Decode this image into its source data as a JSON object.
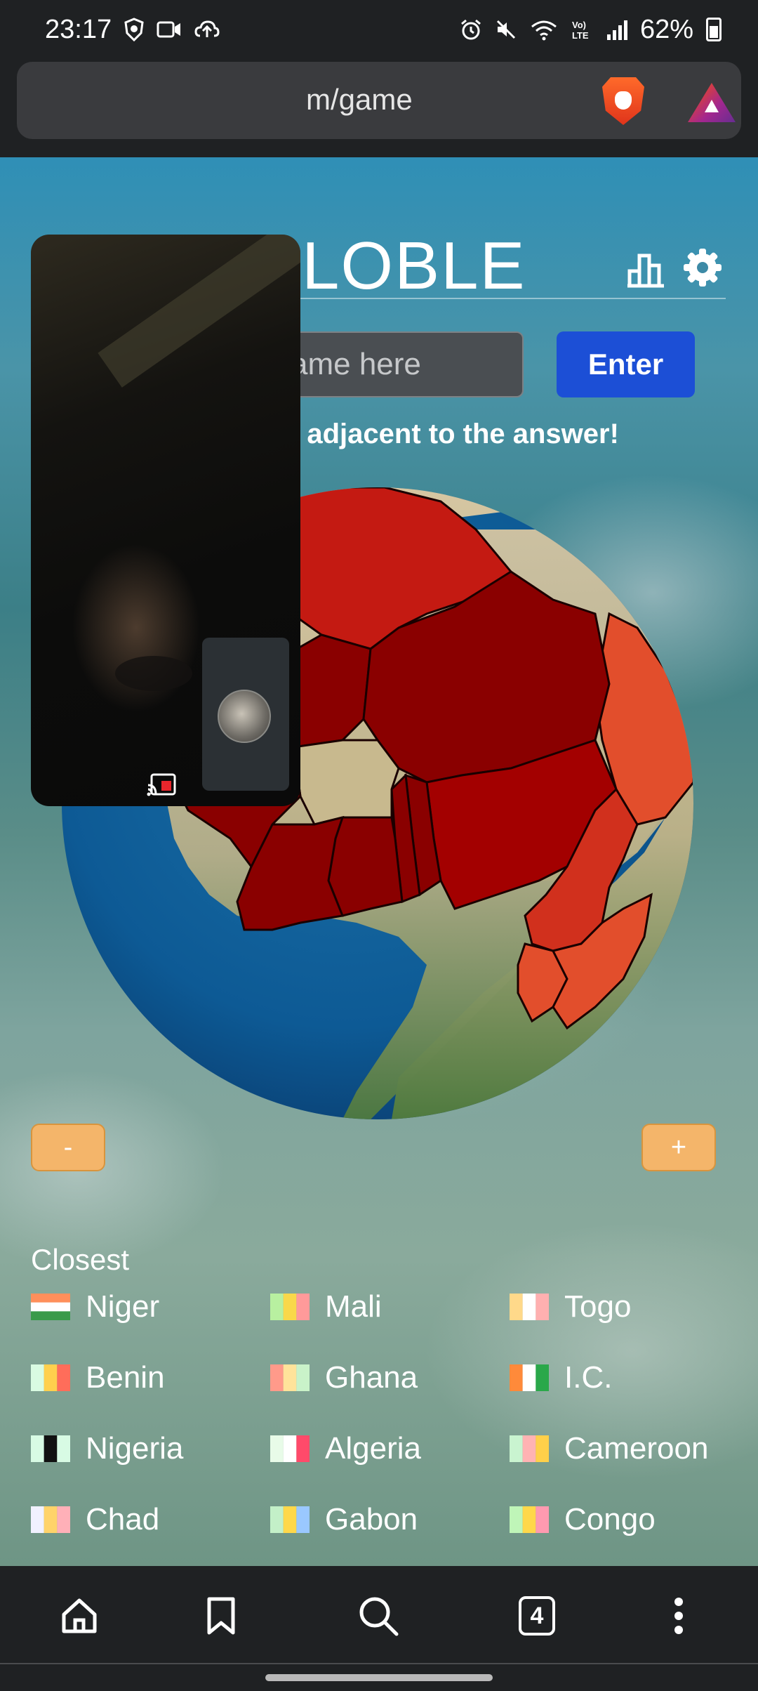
{
  "status_bar": {
    "time": "23:17",
    "battery": "62%",
    "left_icons": [
      "brave-shield-icon",
      "video-icon",
      "cloud-upload-icon"
    ],
    "right_icons": [
      "alarm-icon",
      "mute-icon",
      "wifi-icon",
      "volte-icon",
      "signal-icon",
      "battery-icon"
    ]
  },
  "browser": {
    "url_visible": "m/game",
    "tab_count": "4"
  },
  "game": {
    "title_visible": "LOBLE",
    "input_placeholder": "ame here",
    "enter_label": "Enter",
    "hint": "s adjacent to the answer!",
    "zoom_out": "-",
    "zoom_in": "+",
    "closest_title": "Closest",
    "closest": [
      {
        "name": "Niger",
        "flag": [
          "#ff8f5b",
          "#ffffff",
          "#3a9a4a"
        ]
      },
      {
        "name": "Mali",
        "flag": [
          "#b8f0a0",
          "#f9d84a",
          "#ff9a9a"
        ]
      },
      {
        "name": "Togo",
        "flag": [
          "#ffd98a",
          "#ffffff",
          "#ffb0b0"
        ]
      },
      {
        "name": "Benin",
        "flag": [
          "#d9fbe2",
          "#ffd04d",
          "#ff6d5a"
        ]
      },
      {
        "name": "Ghana",
        "flag": [
          "#ff9a8a",
          "#ffe39a",
          "#c9f2c9"
        ]
      },
      {
        "name": "I.C.",
        "flag": [
          "#ff8a3a",
          "#ffffff",
          "#2aa84a"
        ]
      },
      {
        "name": "Nigeria",
        "flag": [
          "#d8fbe4",
          "#111111",
          "#d8fbe4"
        ]
      },
      {
        "name": "Algeria",
        "flag": [
          "#e8fbe8",
          "#ffffff",
          "#ff4a6a"
        ]
      },
      {
        "name": "Cameroon",
        "flag": [
          "#c9f4d0",
          "#ffb3b3",
          "#ffd04a"
        ]
      },
      {
        "name": "Chad",
        "flag": [
          "#f1f1ff",
          "#ffd36a",
          "#ffb0b8"
        ]
      },
      {
        "name": "Gabon",
        "flag": [
          "#c3f0c8",
          "#ffd84a",
          "#9ac8ff"
        ]
      },
      {
        "name": "Congo",
        "flag": [
          "#bff5b8",
          "#ffd84a",
          "#ff9ab0"
        ]
      }
    ]
  },
  "colors": {
    "enter_button": "#1c4fd6",
    "zoom_button": "#f4b56a",
    "ocean": "#0d5a95",
    "hot_dark": "#8a0000",
    "hot_mid": "#c41a12",
    "hot_light": "#e24e2c"
  },
  "nav": {
    "icons": [
      "home-icon",
      "bookmark-icon",
      "search-icon",
      "tabs-icon",
      "more-menu-icon"
    ]
  }
}
